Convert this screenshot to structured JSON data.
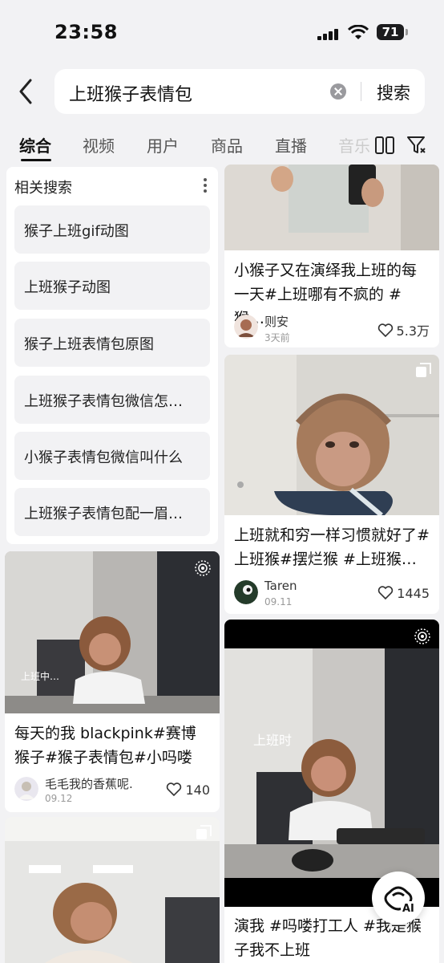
{
  "status_bar": {
    "time": "23:58",
    "battery": "71"
  },
  "search": {
    "query": "上班猴子表情包",
    "button": "搜索"
  },
  "tabs": [
    {
      "label": "综合"
    },
    {
      "label": "视频"
    },
    {
      "label": "用户"
    },
    {
      "label": "商品"
    },
    {
      "label": "直播"
    },
    {
      "label": "音乐"
    }
  ],
  "related": {
    "title": "相关搜索",
    "items": [
      {
        "label": "猴子上班gif动图"
      },
      {
        "label": "上班猴子动图"
      },
      {
        "label": "猴子上班表情包原图"
      },
      {
        "label": "上班猴子表情包微信怎…"
      },
      {
        "label": "小猴子表情包微信叫什么"
      },
      {
        "label": "上班猴子表情包配一眉…"
      }
    ]
  },
  "posts": [
    {
      "title": "小猴子又在演绎我上班的每一天#上班哪有不疯的 #猴…",
      "author": "则安",
      "date": "3天前",
      "likes": "5.3万"
    },
    {
      "title": "上班就和穷一样习惯就好了#上班猴#摆烂猴 #上班猴…",
      "author": "Taren",
      "date": "09.11",
      "likes": "1445"
    },
    {
      "title": "每天的我 blackpink#赛博猴子#猴子表情包#小吗喽",
      "author": "毛毛我的香蕉呢.",
      "date": "09.12",
      "likes": "140",
      "overlay": "上班中…"
    },
    {
      "title": "演我 #吗喽打工人 #我是猴子我不上班",
      "overlay": "上班时"
    }
  ],
  "ai": {
    "label": "AI"
  }
}
